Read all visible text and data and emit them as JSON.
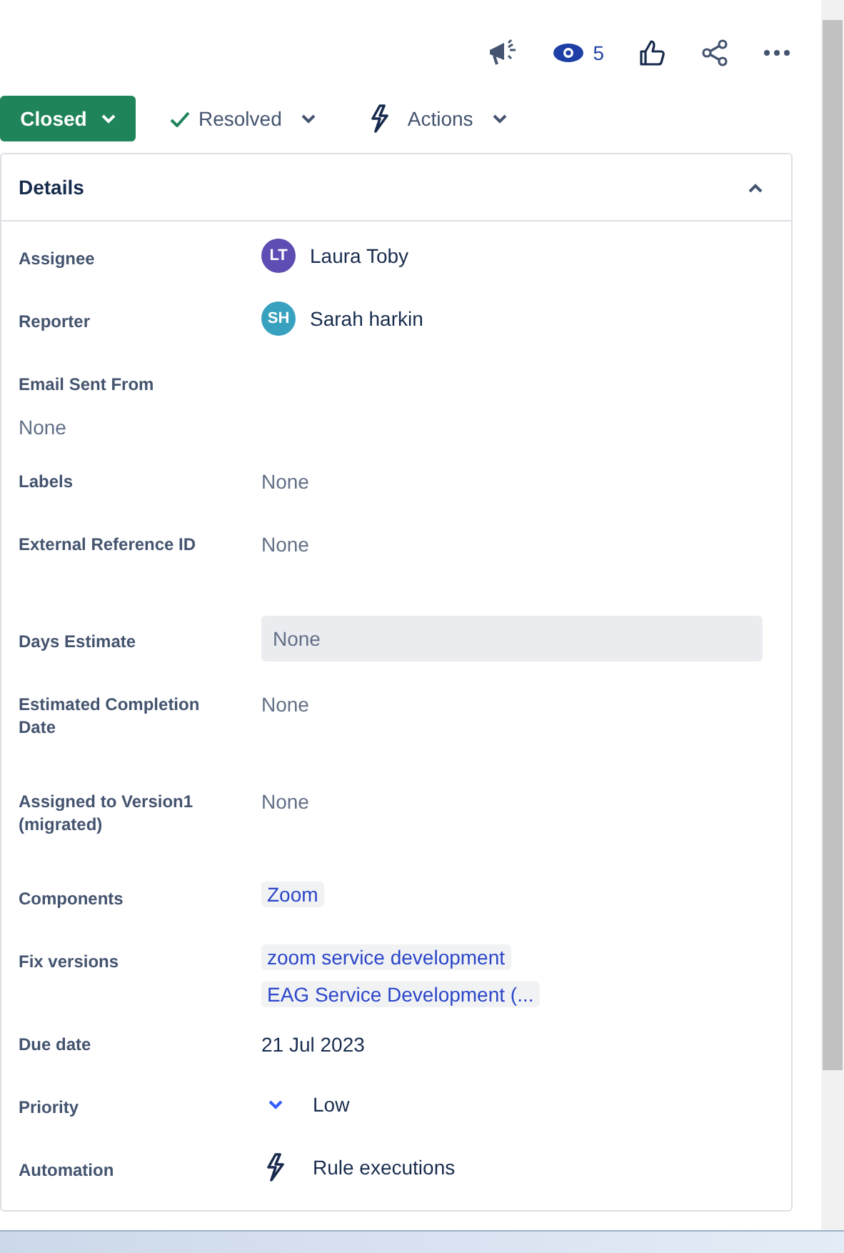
{
  "toolbar": {
    "watchers": "5"
  },
  "status_bar": {
    "status": "Closed",
    "resolution": "Resolved",
    "actions": "Actions"
  },
  "details": {
    "title": "Details",
    "expanded": true,
    "fields": [
      {
        "label": "Assignee",
        "kind": "person",
        "initials": "LT",
        "color": "#5e4db2",
        "value": "Laura Toby"
      },
      {
        "label": "Reporter",
        "kind": "person",
        "initials": "SH",
        "color": "#37a1bf",
        "value": "Sarah harkin"
      },
      {
        "label": "Email Sent From",
        "kind": "stacked",
        "value": "None"
      },
      {
        "label": "Labels",
        "kind": "empty",
        "value": "None"
      },
      {
        "label": "External Reference ID",
        "kind": "empty",
        "value": "None"
      },
      {
        "label": "Days Estimate",
        "kind": "input",
        "value": "None"
      },
      {
        "label": "Estimated Completion Date",
        "kind": "empty",
        "value": "None"
      },
      {
        "label": "Assigned to Version1 (migrated)",
        "kind": "empty",
        "value": "None"
      },
      {
        "label": "Components",
        "kind": "tags",
        "tags": [
          "Zoom"
        ]
      },
      {
        "label": "Fix versions",
        "kind": "tags",
        "tags": [
          "zoom service development",
          "EAG Service Development (..."
        ]
      },
      {
        "label": "Due date",
        "kind": "text",
        "value": "21 Jul 2023"
      },
      {
        "label": "Priority",
        "kind": "priority",
        "value": "Low"
      },
      {
        "label": "Automation",
        "kind": "automation",
        "value": "Rule executions"
      }
    ]
  }
}
